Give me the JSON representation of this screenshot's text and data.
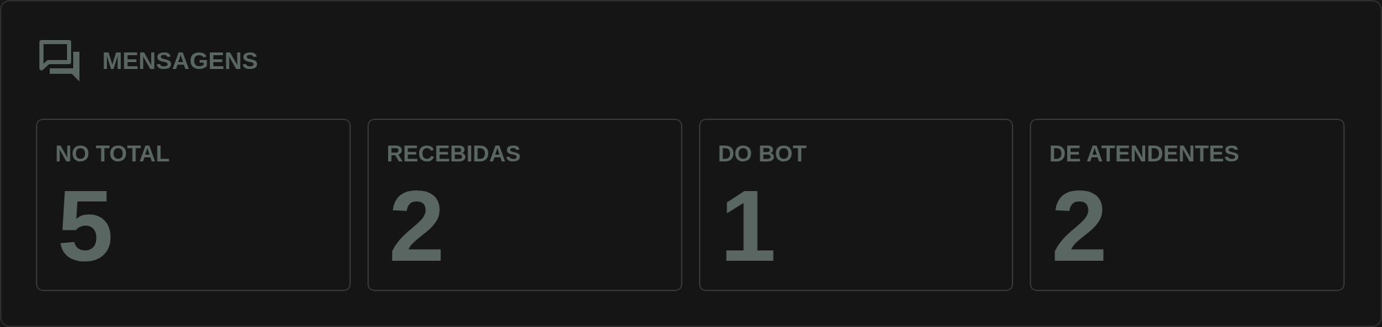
{
  "panel": {
    "title": "MENSAGENS"
  },
  "stats": [
    {
      "label": "NO TOTAL",
      "value": "5"
    },
    {
      "label": "RECEBIDAS",
      "value": "2"
    },
    {
      "label": "DO BOT",
      "value": "1"
    },
    {
      "label": "DE ATENDENTES",
      "value": "2"
    }
  ]
}
